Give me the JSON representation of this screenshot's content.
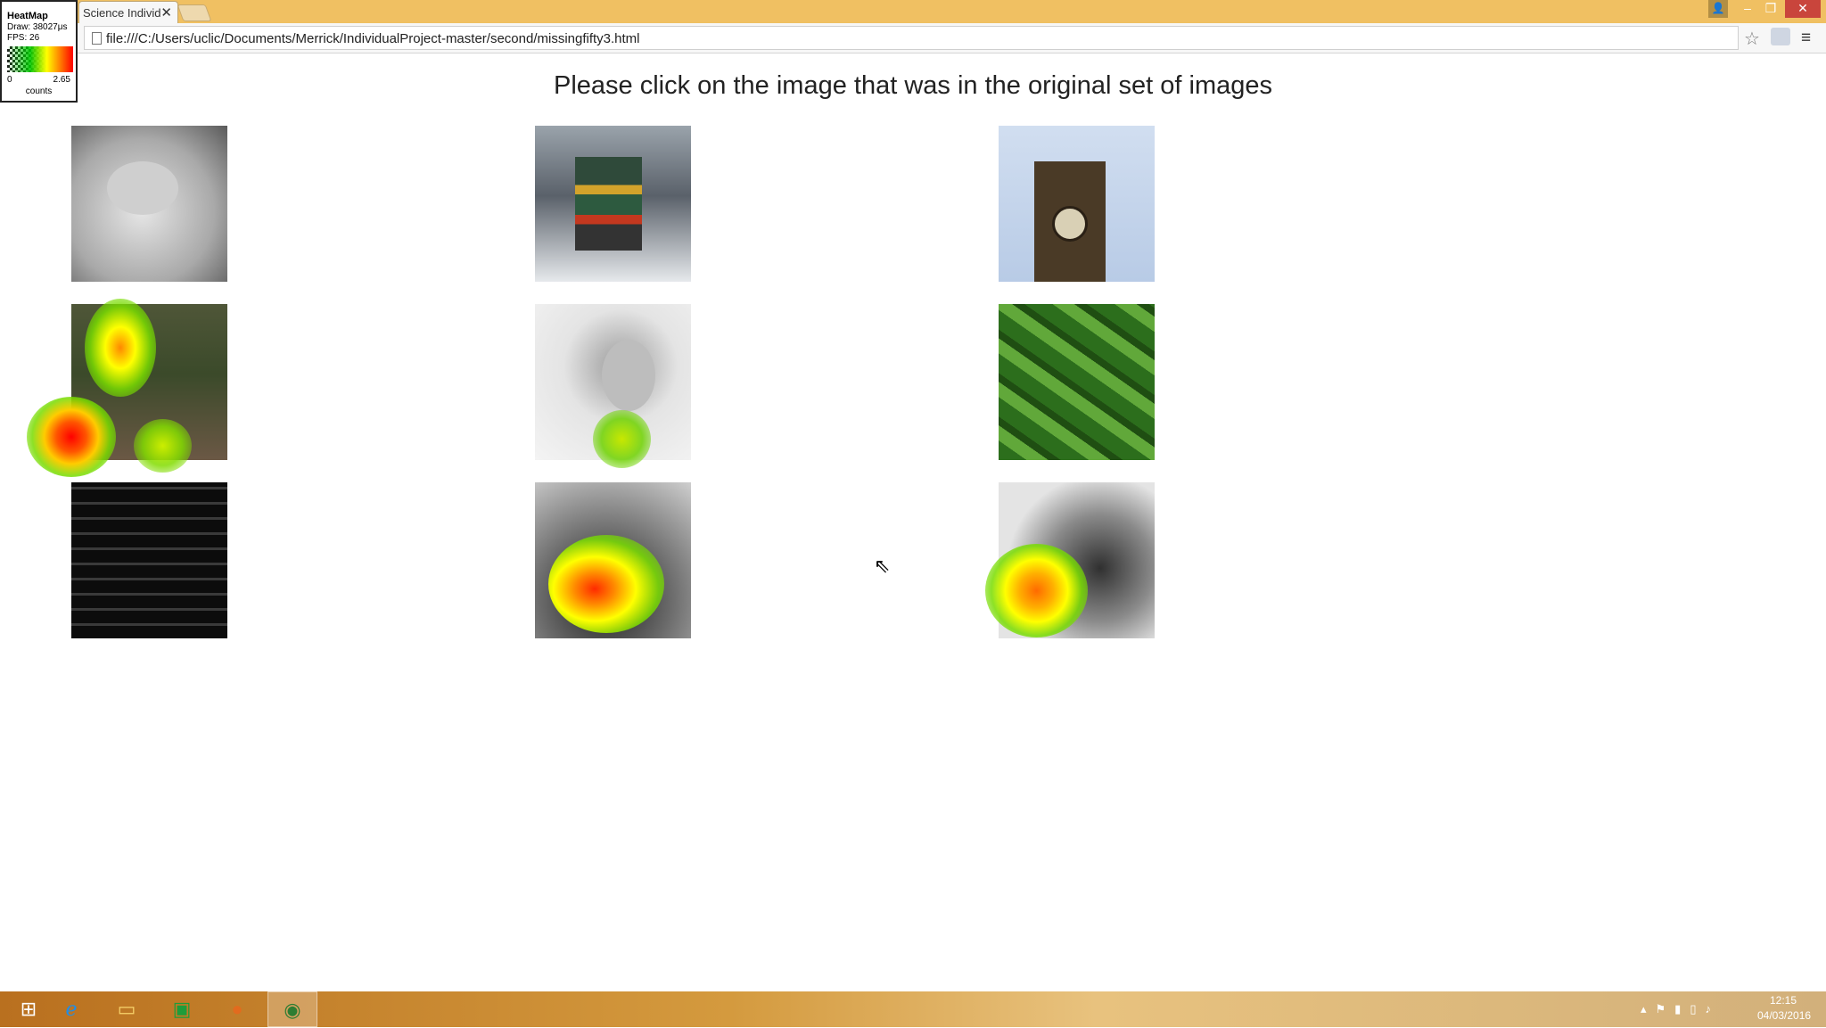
{
  "browser": {
    "tab_title": "Science Individ",
    "tab_close": "✕",
    "url": "file:///C:/Users/uclic/Documents/Merrick/IndividualProject-master/second/missingfifty3.html",
    "star_icon": "star-icon",
    "menu_icon": "hamburger-menu-icon",
    "window_controls": {
      "minimize": "–",
      "maximize": "❐",
      "close": "✕",
      "user": "👤"
    }
  },
  "heatmap": {
    "title": "HeatMap",
    "draw": "Draw: 38027μs",
    "fps": "FPS: 26",
    "min": "0",
    "max": "2.65",
    "unit": "counts"
  },
  "page": {
    "prompt": "Please click on the image that was in the original set of images",
    "images": [
      {
        "name": "sleeping-baby"
      },
      {
        "name": "train"
      },
      {
        "name": "big-ben"
      },
      {
        "name": "forest-path"
      },
      {
        "name": "woman-hood"
      },
      {
        "name": "cucumbers"
      },
      {
        "name": "keyboard"
      },
      {
        "name": "food-plate"
      },
      {
        "name": "bird"
      }
    ]
  },
  "taskbar": {
    "icons": [
      "windows-start-icon",
      "internet-explorer-icon",
      "file-explorer-icon",
      "store-icon",
      "firefox-icon",
      "chrome-icon"
    ],
    "time": "12:15",
    "date": "04/03/2016"
  }
}
